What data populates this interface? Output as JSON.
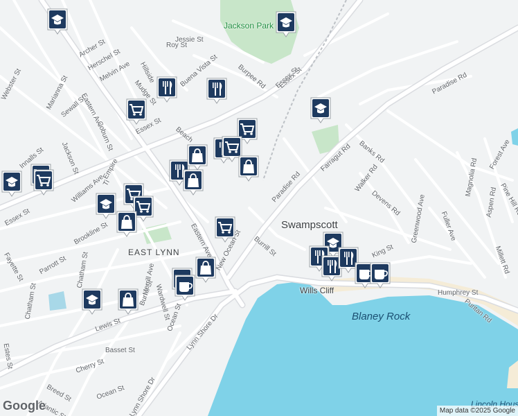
{
  "map": {
    "attribution": "Map data ©2025 Google",
    "logo": "Google",
    "colors": {
      "land": "#f1f3f4",
      "road": "#ffffff",
      "road_edge": "#dadce0",
      "park": "#c8e6c9",
      "water": "#7fd2e8",
      "sand": "#f5ecd7"
    }
  },
  "labels": [
    {
      "id": "jackson-park",
      "text": "Jackson Park",
      "cls": "park"
    },
    {
      "id": "swampscott",
      "text": "Swampscott",
      "cls": "place"
    },
    {
      "id": "east-lynn",
      "text": "EAST LYNN",
      "cls": "area"
    },
    {
      "id": "blaney-rock",
      "text": "Blaney Rock",
      "cls": "water"
    },
    {
      "id": "wills-cliff",
      "text": "Wills Cliff",
      "cls": "sm"
    },
    {
      "id": "lincoln-house-point",
      "text": "Lincoln House Point",
      "cls": "water-small"
    },
    {
      "id": "paradise-rd-1",
      "text": "Paradise Rd",
      "cls": "road"
    },
    {
      "id": "paradise-rd-2",
      "text": "Paradise Rd",
      "cls": "road"
    },
    {
      "id": "essex-st-1",
      "text": "Essex St",
      "cls": "road"
    },
    {
      "id": "essex-st-2",
      "text": "Essex St",
      "cls": "road"
    },
    {
      "id": "essex-st-3",
      "text": "Essex St",
      "cls": "road"
    },
    {
      "id": "eastern-ave-1",
      "text": "Eastern Ave",
      "cls": "road"
    },
    {
      "id": "eastern-ave-2",
      "text": "Eastern Ave",
      "cls": "road"
    },
    {
      "id": "new-ocean-st",
      "text": "New Ocean St",
      "cls": "road"
    },
    {
      "id": "humphrey-st",
      "text": "Humphrey St",
      "cls": "road"
    },
    {
      "id": "lynn-shore-dr-1",
      "text": "Lynn Shore Dr",
      "cls": "road"
    },
    {
      "id": "lynn-shore-dr-2",
      "text": "Lynn Shore Dr",
      "cls": "road"
    },
    {
      "id": "burpee-rd",
      "text": "Burpee Rd",
      "cls": "road"
    },
    {
      "id": "jessie-st",
      "text": "Jessie St",
      "cls": "road"
    },
    {
      "id": "roy-st",
      "text": "Roy St",
      "cls": "road"
    },
    {
      "id": "buena-vista-st",
      "text": "Buena Vista St",
      "cls": "road"
    },
    {
      "id": "hillside",
      "text": "Hillside",
      "cls": "road"
    },
    {
      "id": "mudge-st",
      "text": "Mudge St",
      "cls": "road"
    },
    {
      "id": "archer-st",
      "text": "Archer St",
      "cls": "road"
    },
    {
      "id": "herschel-st",
      "text": "Herschel St",
      "cls": "road"
    },
    {
      "id": "melvin-ave",
      "text": "Melvin Ave",
      "cls": "road"
    },
    {
      "id": "marianna-st",
      "text": "Marianna St",
      "cls": "road"
    },
    {
      "id": "sewall-st",
      "text": "Sewall St",
      "cls": "road"
    },
    {
      "id": "webster-st",
      "text": "Webster St",
      "cls": "road"
    },
    {
      "id": "coburn-st",
      "text": "Coburn St",
      "cls": "road"
    },
    {
      "id": "jackson-st",
      "text": "Jackson St",
      "cls": "road"
    },
    {
      "id": "innalls-st",
      "text": "Innalls St",
      "cls": "road"
    },
    {
      "id": "williams-ave",
      "text": "Williams Ave",
      "cls": "road"
    },
    {
      "id": "brookline-st",
      "text": "Brookline St",
      "cls": "road"
    },
    {
      "id": "fayette-st",
      "text": "Fayette St",
      "cls": "road"
    },
    {
      "id": "parrott-st",
      "text": "Parrott St",
      "cls": "road"
    },
    {
      "id": "chatham-st-1",
      "text": "Chatham St",
      "cls": "road"
    },
    {
      "id": "chatham-st-2",
      "text": "Chatham St",
      "cls": "road"
    },
    {
      "id": "lewis-st",
      "text": "Lewis St",
      "cls": "road"
    },
    {
      "id": "basset-st",
      "text": "Basset St",
      "cls": "road"
    },
    {
      "id": "cherry-st",
      "text": "Cherry St",
      "cls": "road"
    },
    {
      "id": "breed-st",
      "text": "Breed St",
      "cls": "road"
    },
    {
      "id": "atlantic-st",
      "text": "Atlantic St",
      "cls": "road"
    },
    {
      "id": "estes-st",
      "text": "Estes St",
      "cls": "road"
    },
    {
      "id": "ocean-st-1",
      "text": "Ocean St",
      "cls": "road"
    },
    {
      "id": "ocean-st-2",
      "text": "Ocean St",
      "cls": "road"
    },
    {
      "id": "burrill-st-1",
      "text": "Burrill St",
      "cls": "road"
    },
    {
      "id": "burrill-st-2",
      "text": "Burrill St",
      "cls": "road"
    },
    {
      "id": "merrill-ave",
      "text": "Merrill Ave",
      "cls": "road"
    },
    {
      "id": "wardwell-st",
      "text": "Wardwell St",
      "cls": "road"
    },
    {
      "id": "farragut-rd",
      "text": "Farragut Rd",
      "cls": "road"
    },
    {
      "id": "banks-rd",
      "text": "Banks Rd",
      "cls": "road"
    },
    {
      "id": "walker-rd",
      "text": "Walker Rd",
      "cls": "road"
    },
    {
      "id": "devens-rd",
      "text": "Devens Rd",
      "cls": "road"
    },
    {
      "id": "greenwood-ave",
      "text": "Greenwood Ave",
      "cls": "road"
    },
    {
      "id": "fuller-ave",
      "text": "Fuller Ave",
      "cls": "road"
    },
    {
      "id": "magnolia-rd",
      "text": "Magnolia Rd",
      "cls": "road"
    },
    {
      "id": "aspen-rd",
      "text": "Aspen Rd",
      "cls": "road"
    },
    {
      "id": "millett-rd",
      "text": "Millett Rd",
      "cls": "road"
    },
    {
      "id": "pine-hill-rd",
      "text": "Pine Hill Rd",
      "cls": "road"
    },
    {
      "id": "forest-ave",
      "text": "Forest Ave",
      "cls": "road"
    },
    {
      "id": "puritan-rd",
      "text": "Puritan Rd",
      "cls": "road"
    },
    {
      "id": "king-st",
      "text": "King St",
      "cls": "road"
    },
    {
      "id": "beach",
      "text": "Beach",
      "cls": "road"
    },
    {
      "id": "empire",
      "text": "Empire",
      "cls": "road"
    },
    {
      "id": "tirrell",
      "text": "Ti",
      "cls": "road"
    },
    {
      "id": "essex-st-4",
      "text": "Essex St",
      "cls": "road"
    }
  ],
  "pins": [
    {
      "id": "school-1",
      "type": "school"
    },
    {
      "id": "school-2",
      "type": "school"
    },
    {
      "id": "school-3",
      "type": "school"
    },
    {
      "id": "school-4",
      "type": "school"
    },
    {
      "id": "school-5",
      "type": "school"
    },
    {
      "id": "school-6",
      "type": "school"
    },
    {
      "id": "school-7",
      "type": "school"
    },
    {
      "id": "restaurant-1",
      "type": "restaurant"
    },
    {
      "id": "restaurant-2",
      "type": "restaurant"
    },
    {
      "id": "restaurant-3",
      "type": "restaurant"
    },
    {
      "id": "restaurant-4",
      "type": "restaurant"
    },
    {
      "id": "restaurant-5",
      "type": "restaurant"
    },
    {
      "id": "restaurant-6",
      "type": "restaurant"
    },
    {
      "id": "restaurant-7",
      "type": "restaurant"
    },
    {
      "id": "grocery-1",
      "type": "grocery"
    },
    {
      "id": "grocery-2",
      "type": "grocery"
    },
    {
      "id": "grocery-3",
      "type": "grocery"
    },
    {
      "id": "grocery-4",
      "type": "grocery"
    },
    {
      "id": "grocery-5",
      "type": "grocery"
    },
    {
      "id": "grocery-6",
      "type": "grocery"
    },
    {
      "id": "grocery-7",
      "type": "grocery"
    },
    {
      "id": "grocery-8",
      "type": "grocery"
    },
    {
      "id": "shopping-1",
      "type": "shopping"
    },
    {
      "id": "shopping-2",
      "type": "shopping"
    },
    {
      "id": "shopping-3",
      "type": "shopping"
    },
    {
      "id": "shopping-4",
      "type": "shopping"
    },
    {
      "id": "shopping-5",
      "type": "shopping"
    },
    {
      "id": "shopping-6",
      "type": "shopping"
    },
    {
      "id": "cafe-1",
      "type": "cafe"
    },
    {
      "id": "cafe-2",
      "type": "cafe"
    },
    {
      "id": "cafe-3",
      "type": "cafe"
    },
    {
      "id": "cafe-4",
      "type": "cafe"
    }
  ]
}
